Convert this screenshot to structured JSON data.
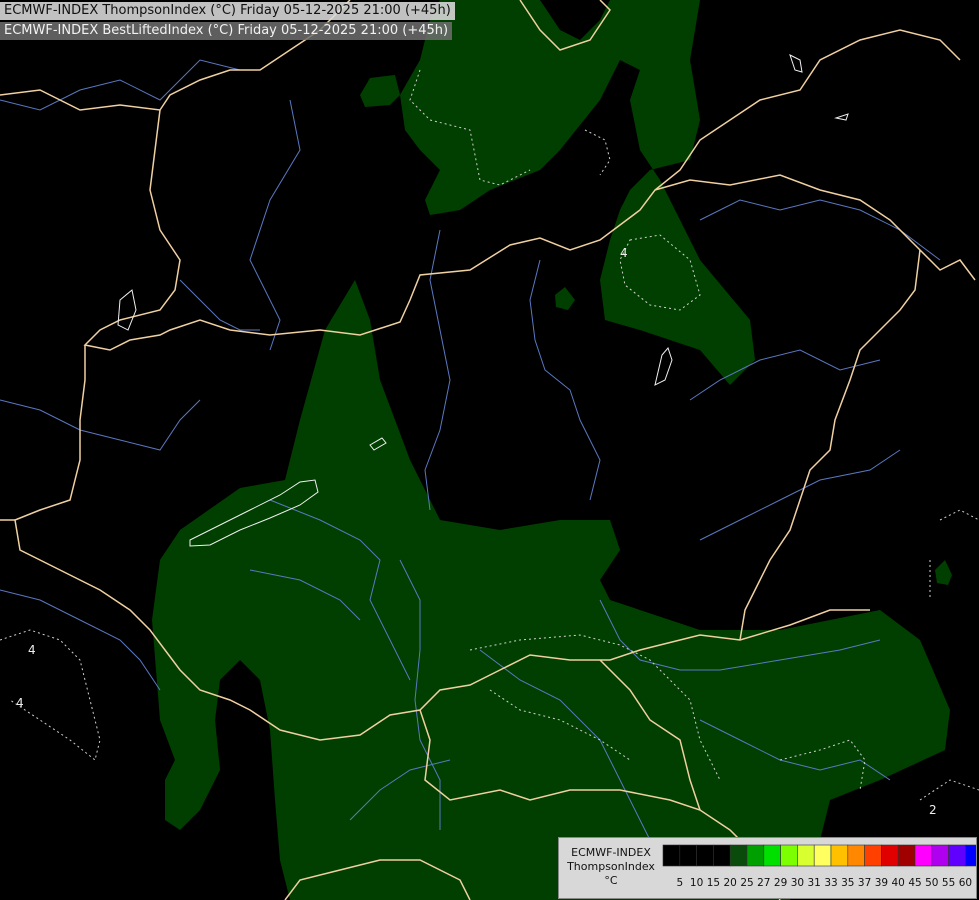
{
  "header": {
    "line1": "ECMWF-INDEX ThompsonIndex (°C) Friday 05-12-2025 21:00 (+45h)",
    "line2": "ECMWF-INDEX BestLiftedIndex (°C) Friday 05-12-2025 21:00 (+45h)"
  },
  "map": {
    "contour_labels": [
      "4",
      "4",
      "4",
      "2"
    ]
  },
  "legend": {
    "title_lines": [
      "ECMWF-INDEX",
      "ThompsonIndex",
      "°C"
    ],
    "ticks": [
      "5",
      "10",
      "15",
      "20",
      "25",
      "27",
      "29",
      "30",
      "31",
      "33",
      "35",
      "37",
      "39",
      "40",
      "45",
      "50",
      "55",
      "60"
    ],
    "colors": [
      "#000000",
      "#000000",
      "#000000",
      "#000000",
      "#0a4a0a",
      "#00a000",
      "#00e000",
      "#7cff00",
      "#d8ff30",
      "#ffff60",
      "#ffc000",
      "#ff8800",
      "#ff4000",
      "#e00000",
      "#a00000",
      "#ff00ff",
      "#b000f0",
      "#6000ff",
      "#0000ff"
    ]
  },
  "colors": {
    "background": "#000000",
    "fill": "#003f00",
    "borders": "#f0d0a0",
    "rivers": "#5a78c0",
    "contours": "#d0d0d0"
  }
}
